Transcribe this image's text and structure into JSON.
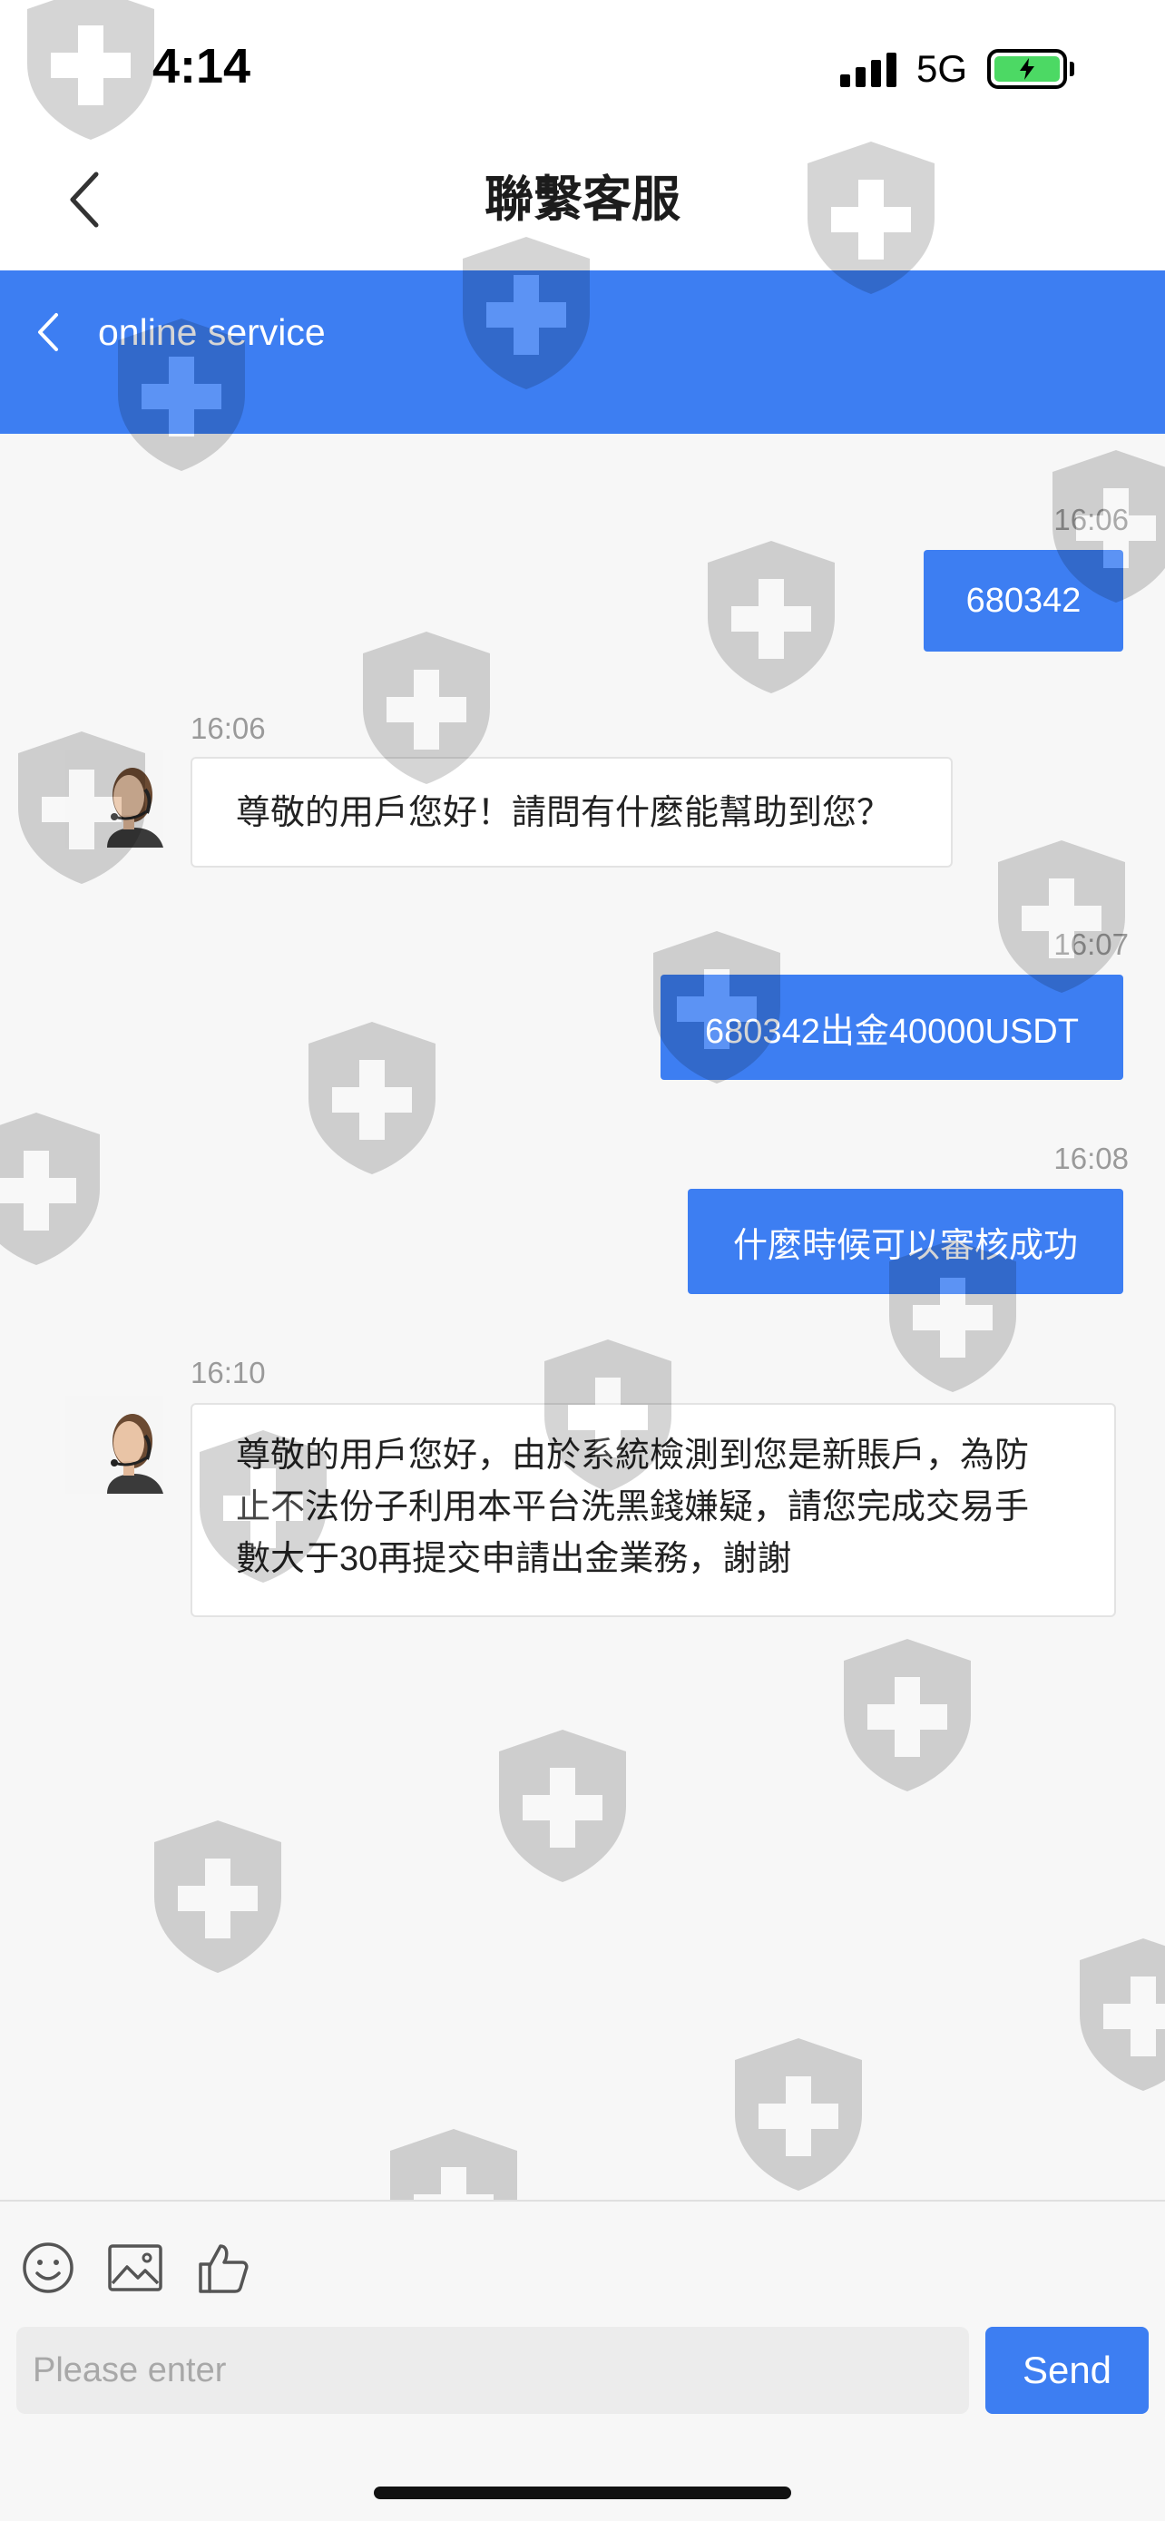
{
  "status_bar": {
    "time": "4:14",
    "network": "5G",
    "battery": "charging"
  },
  "nav": {
    "title": "聯繫客服",
    "back_icon": "chevron-left-icon"
  },
  "service_header": {
    "title": "online service",
    "back_icon": "chevron-left-icon",
    "color": "#3d7ef2"
  },
  "messages": [
    {
      "direction": "outgoing",
      "time": "16:06",
      "text": "680342"
    },
    {
      "direction": "incoming",
      "time": "16:06",
      "text": "尊敬的用戶您好！請問有什麼能幫助到您？",
      "avatar": "agent-avatar"
    },
    {
      "direction": "outgoing",
      "time": "16:07",
      "text": "680342出金40000USDT"
    },
    {
      "direction": "outgoing",
      "time": "16:08",
      "text": "什麼時候可以審核成功"
    },
    {
      "direction": "incoming",
      "time": "16:10",
      "avatar": "agent-avatar",
      "lines": [
        "尊敬的用戶您好，由於系統檢測到您是新賬戶，為防",
        "止不法份子利用本平台洗黑錢嫌疑，請您完成交易手",
        "數大于30再提交申請出金業務，謝謝"
      ]
    }
  ],
  "input_bar": {
    "tools": [
      "emoji-icon",
      "image-icon",
      "thumbs-up-icon"
    ],
    "placeholder": "Please enter",
    "value": "",
    "send_label": "Send"
  },
  "colors": {
    "accent": "#3d7ef2",
    "background": "#f7f7f7"
  }
}
